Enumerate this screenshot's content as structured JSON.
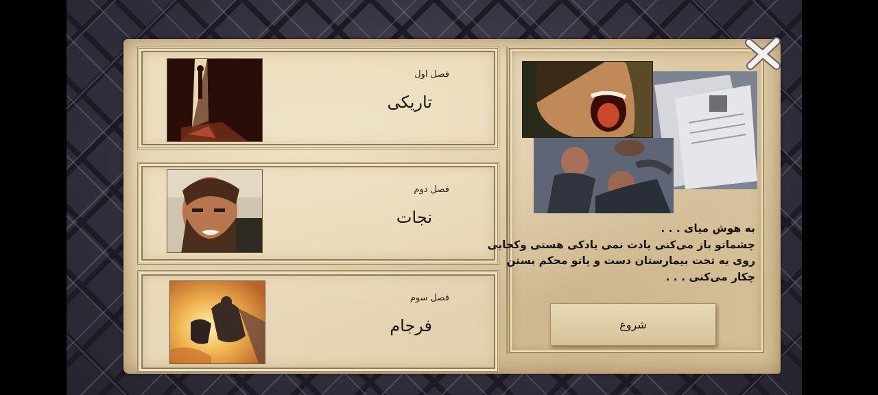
{
  "chapters": [
    {
      "subtitle": "فصل اول",
      "title": "تاریکی",
      "thumb_icon": "dark-doorway-silhouette"
    },
    {
      "subtitle": "فصل دوم",
      "title": "نجات",
      "thumb_icon": "bearded-man-portrait"
    },
    {
      "subtitle": "فصل سوم",
      "title": "فرجام",
      "thumb_icon": "fight-in-flames"
    }
  ],
  "story": {
    "lines": [
      "به هوش میای . . .",
      "چشماتو باز می‌کنی یادت نمی یادکی هستی  وکجایی",
      "روی یه تخت بیمارستان دست  و پاتو  محکم بستن",
      "چکار می‌کنی . . ."
    ]
  },
  "start_label": "شروع",
  "colors": {
    "parchment": "#dccaa4",
    "frame": "#a08b62",
    "text": "#1a130b"
  }
}
